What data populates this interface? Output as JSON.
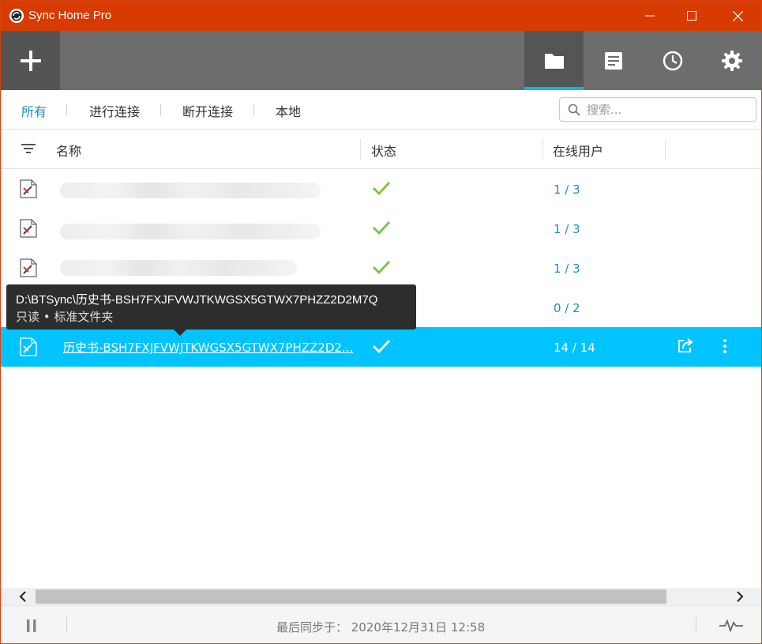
{
  "window": {
    "title": "Sync Home Pro",
    "controls": [
      "minimize-icon",
      "maximize-icon",
      "close-icon"
    ]
  },
  "toolbar": {
    "add_icon": "plus-icon",
    "tabs": [
      {
        "icon": "folder-icon",
        "active": true
      },
      {
        "icon": "document-icon",
        "active": false
      },
      {
        "icon": "clock-icon",
        "active": false
      },
      {
        "icon": "gear-icon",
        "active": false
      }
    ]
  },
  "filters": {
    "tabs": [
      "所有",
      "进行连接",
      "断开连接",
      "本地"
    ],
    "active": "所有",
    "search_placeholder": "搜索..."
  },
  "table": {
    "columns": {
      "name": "名称",
      "status": "状态",
      "online_users": "在线用户"
    },
    "rows": [
      {
        "name_redacted": true,
        "status": "synced",
        "users": "1 / 3"
      },
      {
        "name_redacted": true,
        "status": "synced",
        "users": "1 / 3"
      },
      {
        "name_redacted": true,
        "status": "synced",
        "users": "1 / 3"
      },
      {
        "name_redacted": true,
        "status": "synced",
        "users": "0 / 2"
      },
      {
        "name": "历史书-BSH7FXJFVWJTKWGSX5GTWX7PHZZ2D2...",
        "status": "synced",
        "users": "14 / 14",
        "selected": true
      }
    ]
  },
  "tooltip": {
    "path": "D:\\BTSync\\历史书-BSH7FXJFVWJTKWGSX5GTWX7PHZZ2D2M7Q",
    "subtitle": "只读 • 标准文件夹"
  },
  "statusbar": {
    "last_sync": "最后同步于： 2020年12月31日 12:58"
  },
  "colors": {
    "titlebar": "#d83b01",
    "toolbar": "#6d6d6d",
    "accent": "#00b8f0",
    "selected_row": "#00c3ff",
    "link_blue": "#1a8fc2",
    "check_green": "#7cc242"
  }
}
